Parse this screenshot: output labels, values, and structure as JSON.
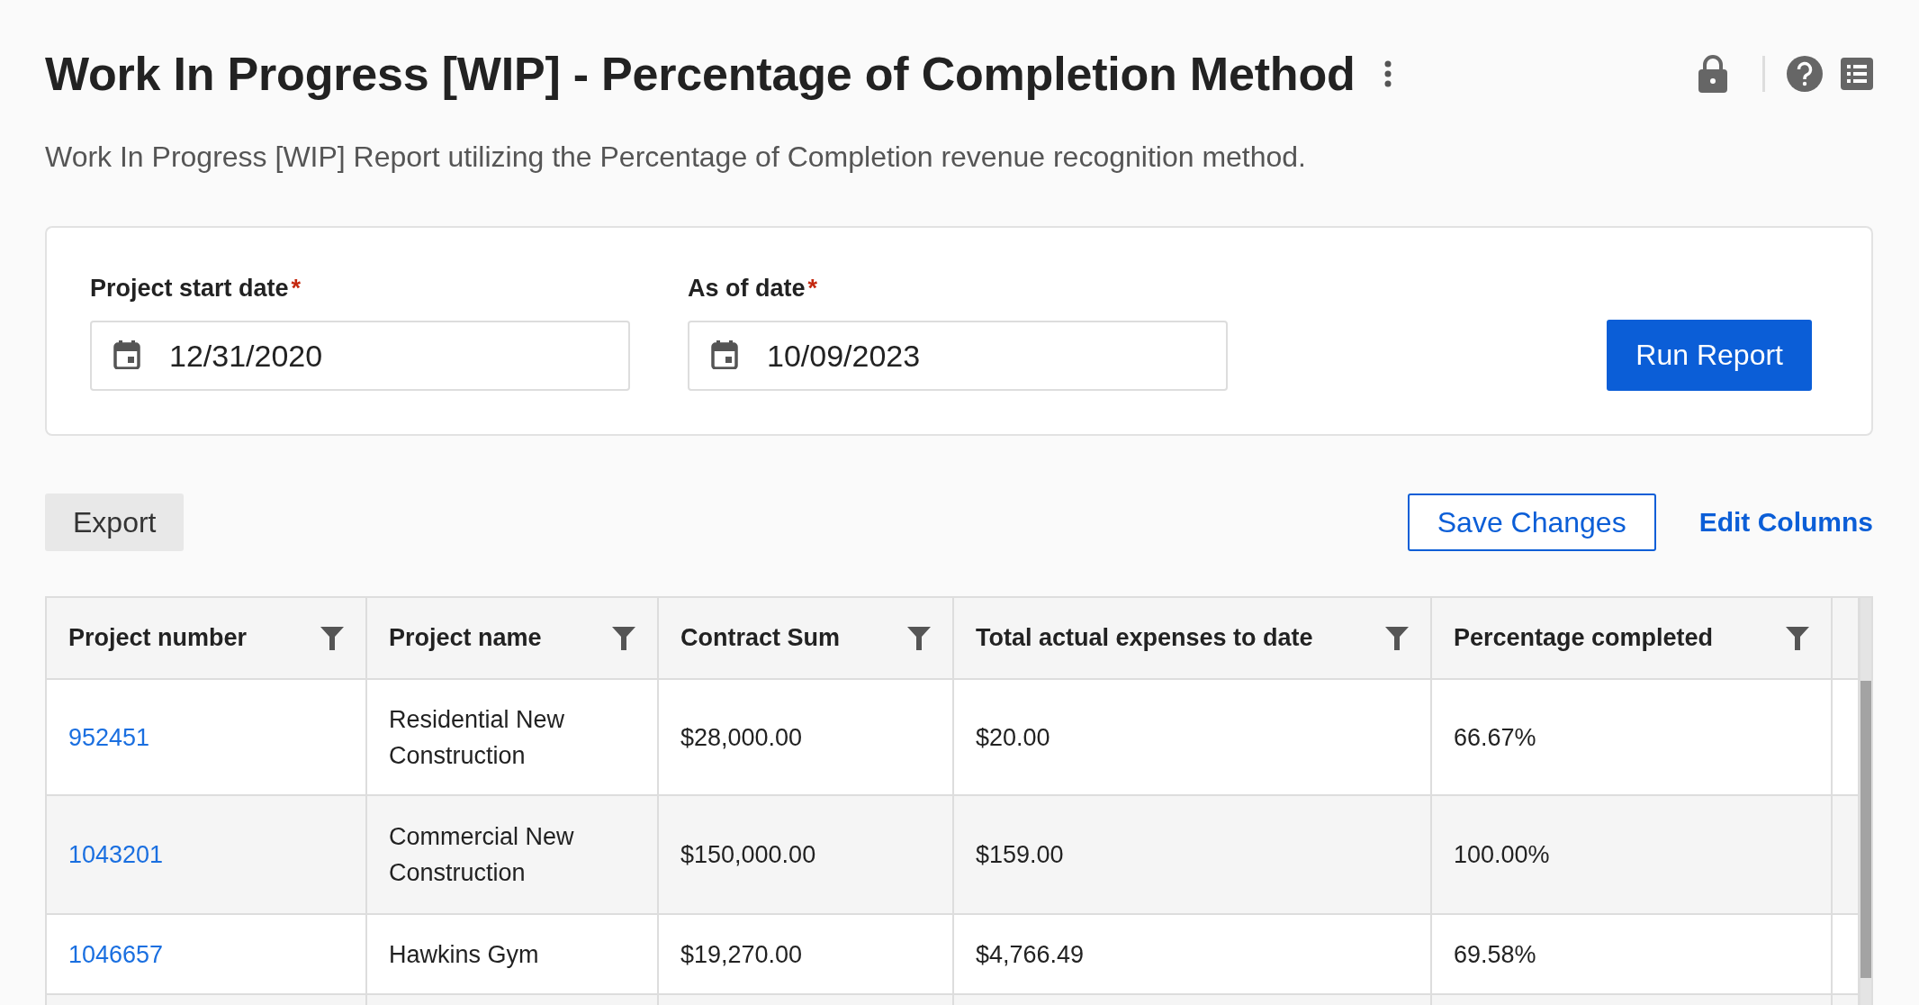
{
  "header": {
    "title": "Work In Progress [WIP] - Percentage of Completion Method",
    "subtitle": "Work In Progress [WIP] Report utilizing the Percentage of Completion revenue recognition method."
  },
  "filters": {
    "fields": [
      {
        "label": "Project start date",
        "required_mark": "*",
        "value": "12/31/2020"
      },
      {
        "label": "As of date",
        "required_mark": "*",
        "value": "10/09/2023"
      }
    ],
    "run_button": "Run Report"
  },
  "toolbar": {
    "export_button": "Export",
    "save_button": "Save Changes",
    "edit_columns_link": "Edit Columns"
  },
  "table": {
    "columns": [
      "Project number",
      "Project name",
      "Contract Sum",
      "Total actual expenses to date",
      "Percentage completed"
    ],
    "rows": [
      {
        "cells": [
          "952451",
          "Residential New Construction",
          "$28,000.00",
          "$20.00",
          "66.67%"
        ]
      },
      {
        "cells": [
          "1043201",
          "Commercial New Construction",
          "$150,000.00",
          "$159.00",
          "100.00%"
        ]
      },
      {
        "cells": [
          "1046657",
          "Hawkins Gym",
          "$19,270.00",
          "$4,766.49",
          "69.58%"
        ]
      }
    ]
  }
}
